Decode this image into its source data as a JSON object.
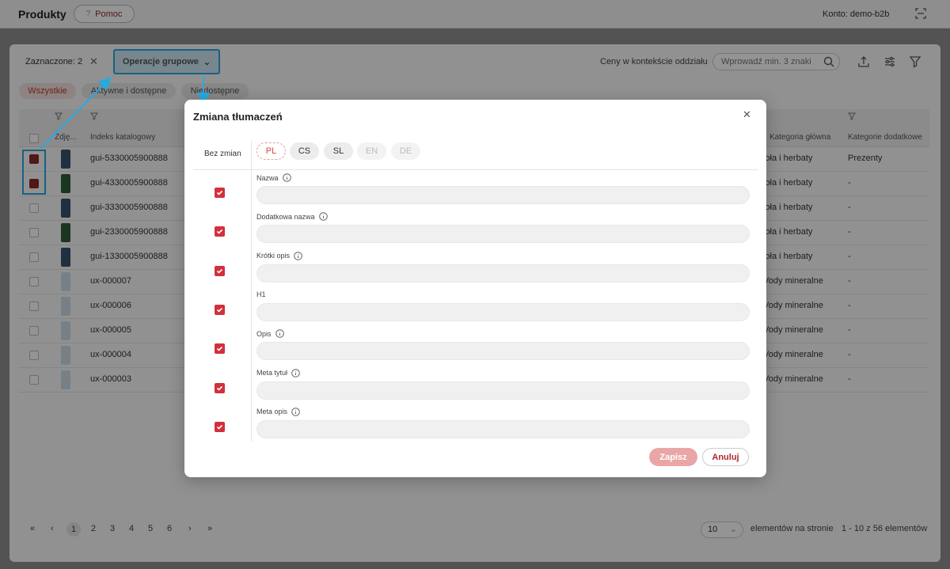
{
  "header": {
    "title": "Produkty",
    "help_label": "Pomoc",
    "account": "Konto: demo-b2b"
  },
  "toolbar": {
    "selected": "Zaznaczone: 2",
    "group_ops": "Operacje grupowe",
    "price_context": "Ceny w kontekście oddziału",
    "search_placeholder": "Wprowadź min. 3 znaki"
  },
  "filters": [
    "Wszystkie",
    "Aktywne i dostępne",
    "Niedostępne"
  ],
  "table": {
    "headers": {
      "photo": "Zdję...",
      "index": "Indeks katalogowy",
      "category": "Kategoria główna",
      "extra": "Kategorie dodatkowe"
    },
    "rows": [
      {
        "index": "gui-5330005900888",
        "category": "ioła i herbaty",
        "extra": "Prezenty",
        "checked": true
      },
      {
        "index": "gui-4330005900888",
        "category": "ioła i herbaty",
        "extra": "-",
        "checked": true
      },
      {
        "index": "gui-3330005900888",
        "category": "ioła i herbaty",
        "extra": "-",
        "checked": false
      },
      {
        "index": "gui-2330005900888",
        "category": "ioła i herbaty",
        "extra": "-",
        "checked": false
      },
      {
        "index": "gui-1330005900888",
        "category": "ioła i herbaty",
        "extra": "-",
        "checked": false
      },
      {
        "index": "ux-000007",
        "category": "Vody mineralne",
        "extra": "-",
        "checked": false
      },
      {
        "index": "ux-000006",
        "category": "Vody mineralne",
        "extra": "-",
        "checked": false
      },
      {
        "index": "ux-000005",
        "category": "Vody mineralne",
        "extra": "-",
        "checked": false
      },
      {
        "index": "ux-000004",
        "category": "Vody mineralne",
        "extra": "-",
        "checked": false
      },
      {
        "index": "ux-000003",
        "category": "Vody mineralne",
        "extra": "-",
        "checked": false
      }
    ]
  },
  "pagination": {
    "pages": [
      "1",
      "2",
      "3",
      "4",
      "5",
      "6"
    ],
    "per_page": "10",
    "per_page_label": "elementów na stronie",
    "range": "1 - 10 z 56 elementów"
  },
  "modal": {
    "title": "Zmiana tłumaczeń",
    "no_change": "Bez zmian",
    "languages": [
      "PL",
      "CS",
      "SL",
      "EN",
      "DE"
    ],
    "fields": [
      "Nazwa",
      "Dodatkowa nazwa",
      "Krótki opis",
      "H1",
      "Opis",
      "Meta tytuł",
      "Meta opis"
    ],
    "save": "Zapisz",
    "cancel": "Anuluj"
  },
  "colors": {
    "accent": "#d32f3c",
    "highlight": "#28a9e0"
  }
}
